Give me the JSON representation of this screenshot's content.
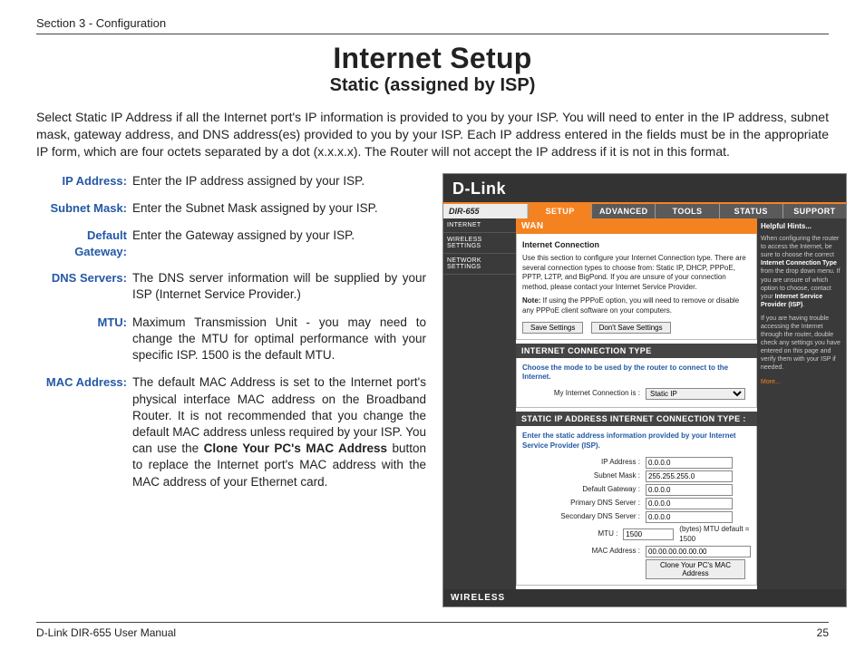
{
  "section_label": "Section 3 - Configuration",
  "title": "Internet Setup",
  "subtitle": "Static (assigned by ISP)",
  "intro": "Select Static IP Address if all the Internet port's IP information is provided to you by your ISP. You will need to enter in the IP address, subnet mask, gateway address, and DNS address(es) provided to you by your ISP. Each IP address entered in the fields must be in the appropriate IP form, which are four octets separated by a dot (x.x.x.x). The Router will not accept the IP address if it is not in this format.",
  "defs": [
    {
      "label": "IP Address:",
      "body_plain": "Enter the IP address assigned by your ISP."
    },
    {
      "label": "Subnet Mask:",
      "body_plain": "Enter the Subnet Mask assigned by your ISP."
    },
    {
      "label": "Default Gateway:",
      "body_plain": "Enter the Gateway assigned by your ISP."
    },
    {
      "label": "DNS Servers:",
      "body_plain": "The DNS server information will be supplied by your ISP (Internet Service Provider.)"
    },
    {
      "label": "MTU:",
      "body_plain": "Maximum Transmission Unit - you may need to change the MTU for optimal performance with your specific ISP. 1500 is the default MTU."
    },
    {
      "label": "MAC Address:",
      "body_pre": "The default MAC Address is set to the Internet port's physical interface MAC address on the Broadband Router. It is not recommended that you change the default MAC address unless required by your ISP. You can use the ",
      "body_bold": "Clone Your PC's MAC Address",
      "body_post": " button to replace the Internet port's MAC address with the MAC address of your Ethernet card."
    }
  ],
  "ui": {
    "logo": "D-Link",
    "model": "DIR-655",
    "tabs": [
      "SETUP",
      "ADVANCED",
      "TOOLS",
      "STATUS",
      "SUPPORT"
    ],
    "active_tab": "SETUP",
    "side": [
      "INTERNET",
      "WIRELESS SETTINGS",
      "NETWORK SETTINGS"
    ],
    "wan": {
      "title": "WAN",
      "subtitle": "Internet Connection",
      "desc": "Use this section to configure your Internet Connection type. There are several connection types to choose from: Static IP, DHCP, PPPoE, PPTP, L2TP, and BigPond. If you are unsure of your connection method, please contact your Internet Service Provider.",
      "note_label": "Note:",
      "note": " If using the PPPoE option, you will need to remove or disable any PPPoE client software on your computers.",
      "save": "Save Settings",
      "dont_save": "Don't Save Settings"
    },
    "conn_type": {
      "title": "INTERNET CONNECTION TYPE",
      "desc": "Choose the mode to be used by the router to connect to the Internet.",
      "field_label": "My Internet Connection is :",
      "selected": "Static IP"
    },
    "static_section": {
      "title": "STATIC IP ADDRESS INTERNET CONNECTION TYPE :",
      "desc": "Enter the static address information provided by your Internet Service Provider (ISP).",
      "fields": {
        "ip_label": "IP Address :",
        "ip_value": "0.0.0.0",
        "mask_label": "Subnet Mask :",
        "mask_value": "255.255.255.0",
        "gw_label": "Default Gateway :",
        "gw_value": "0.0.0.0",
        "dns1_label": "Primary DNS Server :",
        "dns1_value": "0.0.0.0",
        "dns2_label": "Secondary DNS Server :",
        "dns2_value": "0.0.0.0",
        "mtu_label": "MTU :",
        "mtu_value": "1500",
        "mtu_hint": "(bytes)   MTU default = 1500",
        "mac_label": "MAC Address :",
        "mac_value": "00.00.00.00.00.00",
        "clone": "Clone Your PC's MAC Address"
      }
    },
    "footer": "WIRELESS",
    "help": {
      "title": "Helpful Hints...",
      "p1a": "When configuring the router to access the Internet, be sure to choose the correct ",
      "p1b": "Internet Connection Type",
      "p1c": " from the drop down menu. If you are unsure of which option to choose, contact your ",
      "p1d": "Internet Service Provider (ISP)",
      "p1e": ".",
      "p2": "If you are having trouble accessing the Internet through the router, double check any settings you have entered on this page and verify them with your ISP if needed.",
      "more": "More..."
    }
  },
  "footer_left": "D-Link DIR-655 User Manual",
  "footer_right": "25"
}
